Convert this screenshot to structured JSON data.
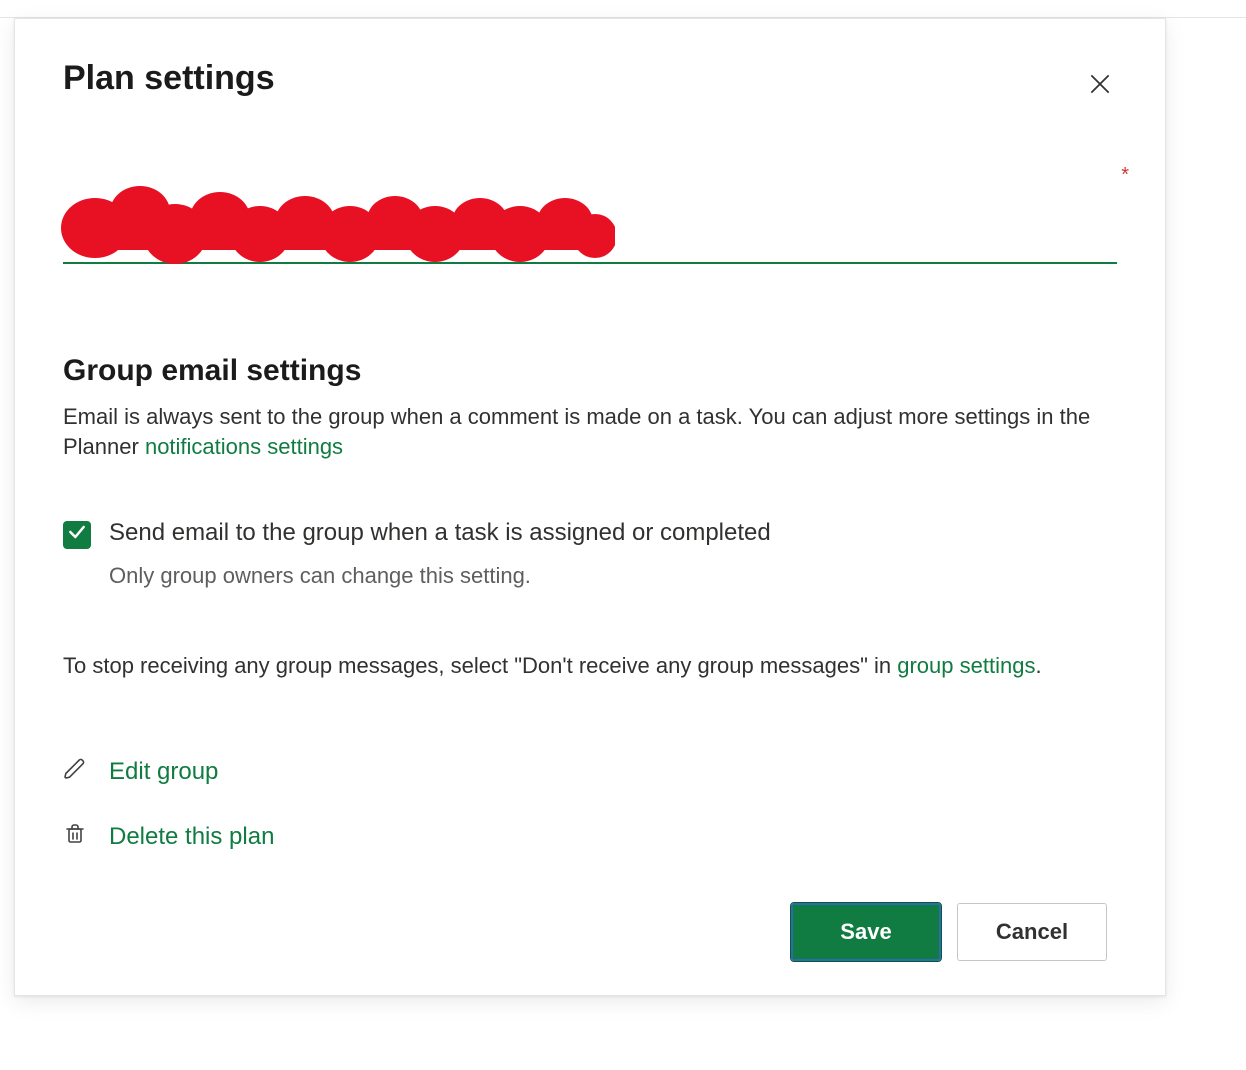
{
  "dialog": {
    "title": "Plan settings",
    "required_marker": "*",
    "section_title": "Group email settings",
    "section_desc_prefix": "Email is always sent to the group when a comment is made on a task. You can adjust more settings in the Planner ",
    "notifications_link": "notifications settings",
    "checkbox_label": "Send email to the group when a task is assigned or completed",
    "checkbox_checked": true,
    "checkbox_note": "Only group owners can change this setting.",
    "stop_text_prefix": "To stop receiving any group messages, select \"Don't receive any group messages\" in ",
    "group_settings_link": "group settings",
    "stop_text_suffix": ".",
    "edit_group_label": "Edit group",
    "delete_plan_label": "Delete this plan",
    "save_label": "Save",
    "cancel_label": "Cancel"
  }
}
